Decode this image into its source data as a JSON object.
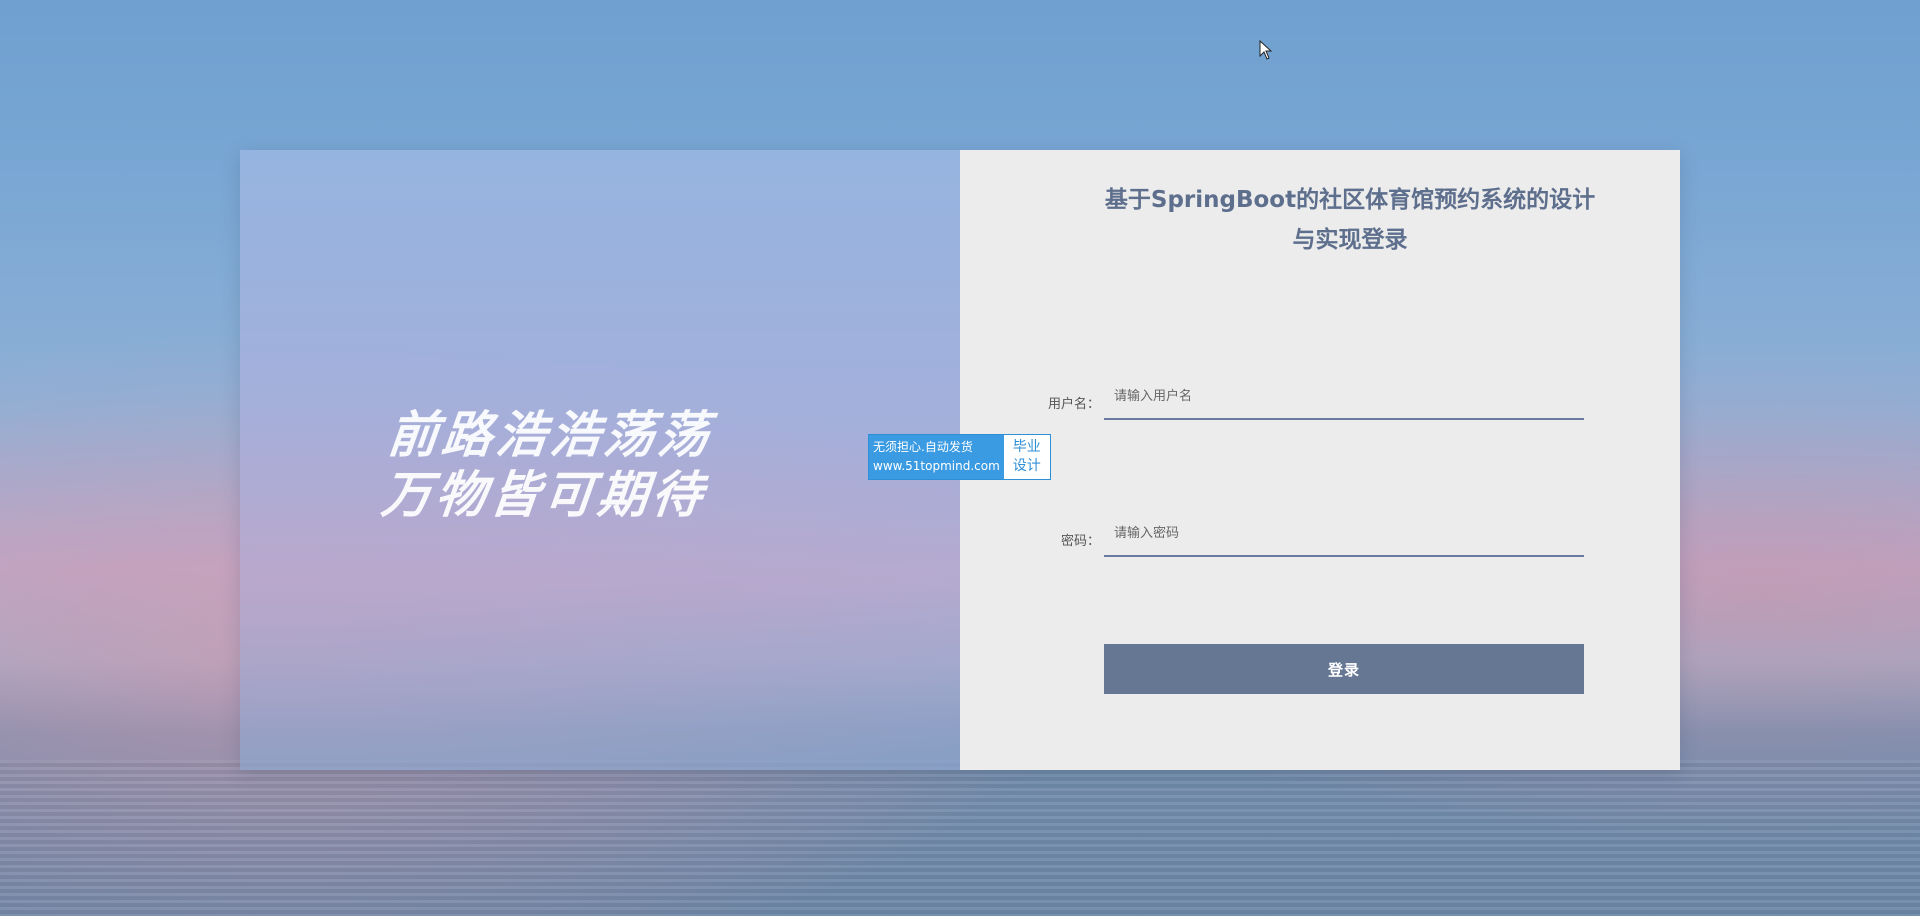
{
  "slogan": {
    "line1": "前路浩浩荡荡",
    "line2": "万物皆可期待"
  },
  "login": {
    "title": "基于SpringBoot的社区体育馆预约系统的设计与实现登录",
    "username_label": "用户名：",
    "username_placeholder": "请输入用户名",
    "password_label": "密码：",
    "password_placeholder": "请输入密码",
    "submit_label": "登录"
  },
  "watermark": {
    "line1": "无须担心.自动发货",
    "line2": "www.51topmind.com",
    "side": "毕业设计"
  },
  "colors": {
    "accent": "#667794",
    "title": "#5e6f8d",
    "panel": "#ececec"
  }
}
